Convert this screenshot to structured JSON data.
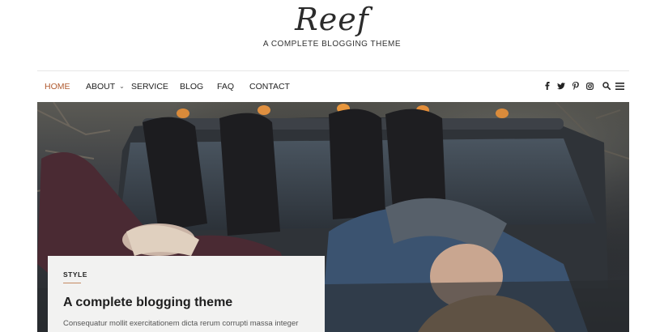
{
  "site": {
    "logo": "Reef",
    "tagline": "A COMPLETE BLOGGING THEME"
  },
  "nav": {
    "items": [
      {
        "label": "HOME",
        "active": true
      },
      {
        "label": "ABOUT",
        "has_dropdown": true
      },
      {
        "label": "SERVICE"
      },
      {
        "label": "BLOG"
      },
      {
        "label": "FAQ"
      },
      {
        "label": "CONTACT"
      }
    ],
    "social_icons": [
      "facebook-icon",
      "twitter-icon",
      "pinterest-icon",
      "instagram-icon"
    ],
    "tools": [
      "search-icon",
      "menu-icon"
    ]
  },
  "featured": {
    "category": "STYLE",
    "title": "A complete blogging theme",
    "excerpt": "Consequatur mollit exercitationem dicta rerum corrupti massa integer"
  },
  "colors": {
    "accent": "#b05a2f",
    "card_bg": "#f2f2f1"
  }
}
